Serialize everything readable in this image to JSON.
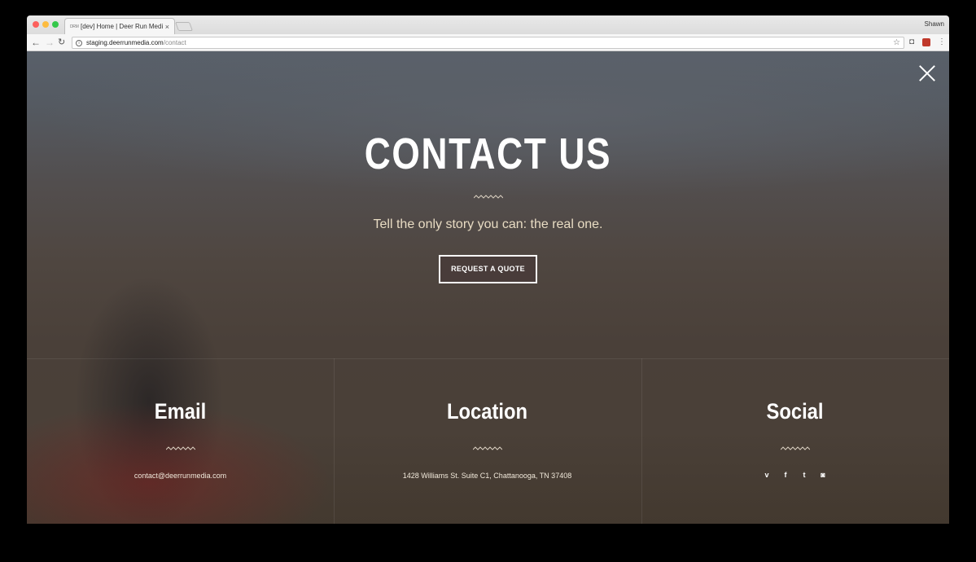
{
  "browser": {
    "tab_favicon": "DRM",
    "tab_title": "[dev] Home | Deer Run Media",
    "tab_close": "×",
    "profile_name": "Shawn",
    "url_host": "staging.deerrunmedia.com",
    "url_path": "/contact",
    "back_icon": "←",
    "forward_icon": "→",
    "reload_icon": "↻",
    "star_icon": "☆",
    "menu_icon": "⋮",
    "info_icon": "i"
  },
  "hero": {
    "title": "CONTACT US",
    "tagline": "Tell the only story you can: the real one.",
    "button_label": "REQUEST A QUOTE"
  },
  "columns": {
    "email": {
      "title": "Email",
      "text": "contact@deerrunmedia.com"
    },
    "location": {
      "title": "Location",
      "text": "1428 Williams St. Suite C1, Chattanooga, TN 37408"
    },
    "social": {
      "title": "Social",
      "icons": {
        "vimeo": "v",
        "facebook": "f",
        "twitter": "t",
        "instagram": "◙"
      }
    }
  },
  "colors": {
    "accent_squiggle": "#d9cfc0",
    "tagline": "#e8dcc3"
  }
}
